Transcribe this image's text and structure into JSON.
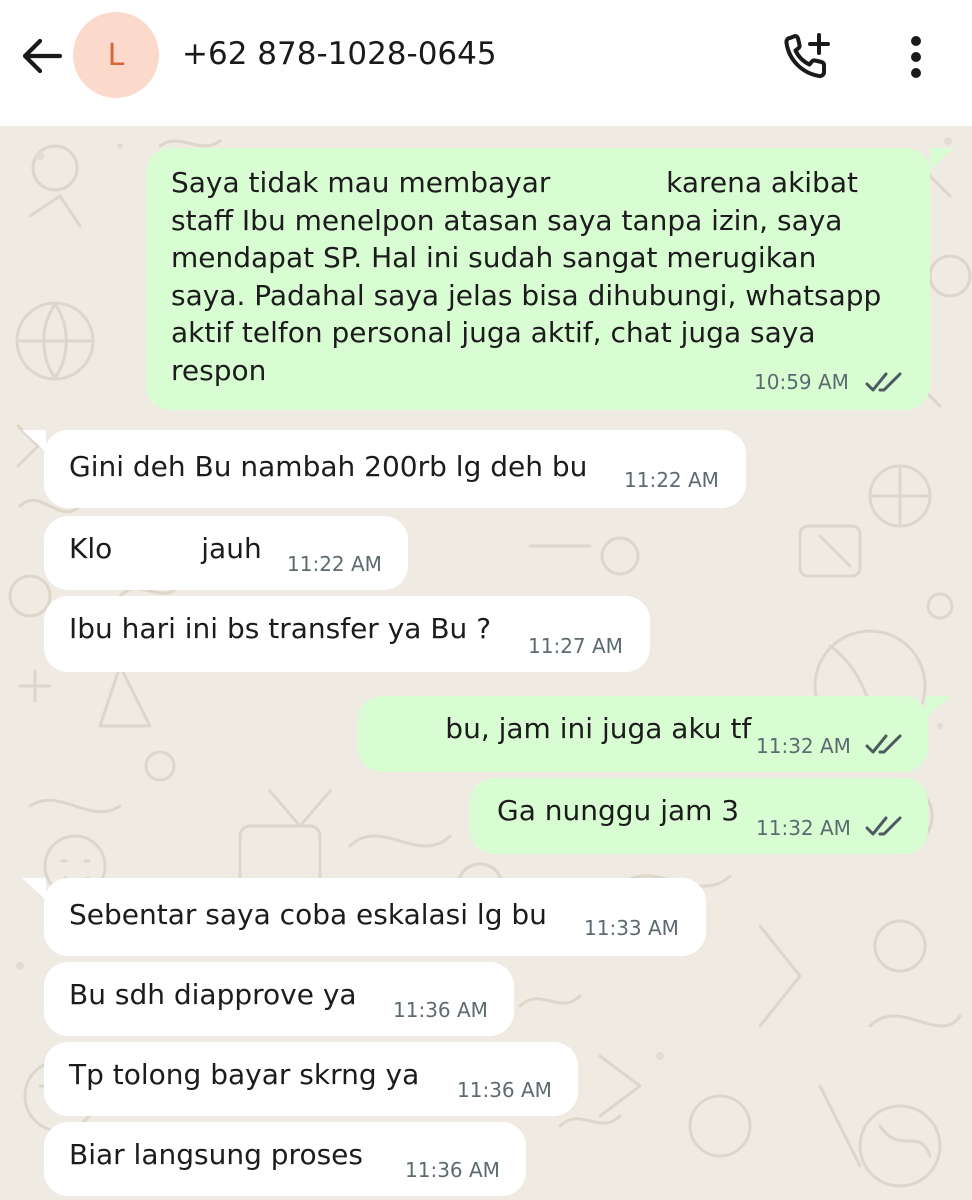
{
  "header": {
    "avatar_letter": "L",
    "contact": "+62 878-1028-0645",
    "back_icon": "arrow-left-icon",
    "call_icon": "add-call-icon",
    "menu_icon": "more-vertical-icon"
  },
  "colors": {
    "incoming_bubble": "#ffffff",
    "outgoing_bubble": "#d9fdd3",
    "chat_background": "#efeae2",
    "read_ticks": "#4d5a5f",
    "avatar_bg": "#fbd9cb",
    "avatar_fg": "#d9653a"
  },
  "messages": [
    {
      "direction": "out",
      "lines": [
        "Saya tidak mau membayar             karena akibat",
        "staff Ibu menelpon atasan saya tanpa izin, saya",
        "mendapat SP. Hal ini sudah sangat merugikan",
        "saya. Padahal saya jelas bisa dihubungi, whatsapp",
        "aktif telfon personal juga aktif, chat juga saya",
        "respon"
      ],
      "time": "10:59 AM",
      "status": "read"
    },
    {
      "direction": "in",
      "lines": [
        "Gini deh Bu nambah 200rb lg deh bu"
      ],
      "time": "11:22 AM"
    },
    {
      "direction": "in",
      "lines": [
        "Klo          jauh"
      ],
      "time": "11:22 AM"
    },
    {
      "direction": "in",
      "lines": [
        "Ibu hari ini bs transfer ya Bu ?"
      ],
      "time": "11:27 AM"
    },
    {
      "direction": "out",
      "lines": [
        "       bu, jam ini juga aku tf"
      ],
      "time": "11:32 AM",
      "status": "read"
    },
    {
      "direction": "out",
      "lines": [
        "Ga nunggu jam 3"
      ],
      "time": "11:32 AM",
      "status": "read"
    },
    {
      "direction": "in",
      "lines": [
        "Sebentar saya coba eskalasi lg bu"
      ],
      "time": "11:33 AM"
    },
    {
      "direction": "in",
      "lines": [
        "Bu sdh diapprove ya"
      ],
      "time": "11:36 AM"
    },
    {
      "direction": "in",
      "lines": [
        "Tp tolong bayar skrng ya"
      ],
      "time": "11:36 AM"
    },
    {
      "direction": "in",
      "lines": [
        "Biar langsung proses"
      ],
      "time": "11:36 AM"
    }
  ]
}
